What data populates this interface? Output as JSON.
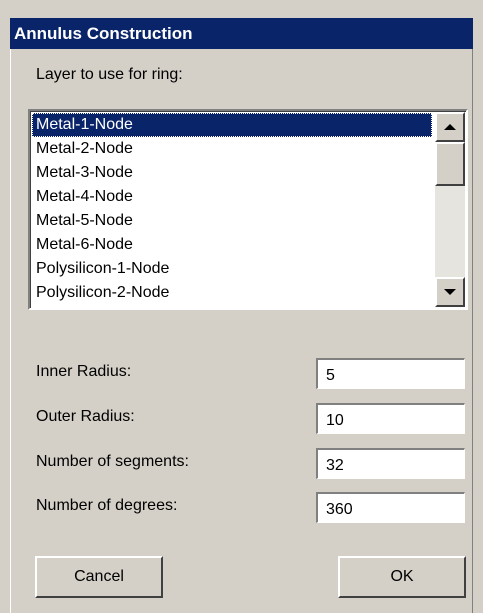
{
  "window": {
    "title": "Annulus Construction"
  },
  "layer": {
    "label": "Layer to use for ring:",
    "items": [
      "Metal-1-Node",
      "Metal-2-Node",
      "Metal-3-Node",
      "Metal-4-Node",
      "Metal-5-Node",
      "Metal-6-Node",
      "Polysilicon-1-Node",
      "Polysilicon-2-Node"
    ],
    "selected_index": 0
  },
  "fields": {
    "inner_radius": {
      "label": "Inner Radius:",
      "value": "5"
    },
    "outer_radius": {
      "label": "Outer Radius:",
      "value": "10"
    },
    "segments": {
      "label": "Number of segments:",
      "value": "32"
    },
    "degrees": {
      "label": "Number of degrees:",
      "value": "360"
    }
  },
  "buttons": {
    "cancel": "Cancel",
    "ok": "OK"
  },
  "colors": {
    "title_bar": "#0a246a",
    "dialog_bg": "#d4d0c8",
    "selection": "#0a246a"
  }
}
